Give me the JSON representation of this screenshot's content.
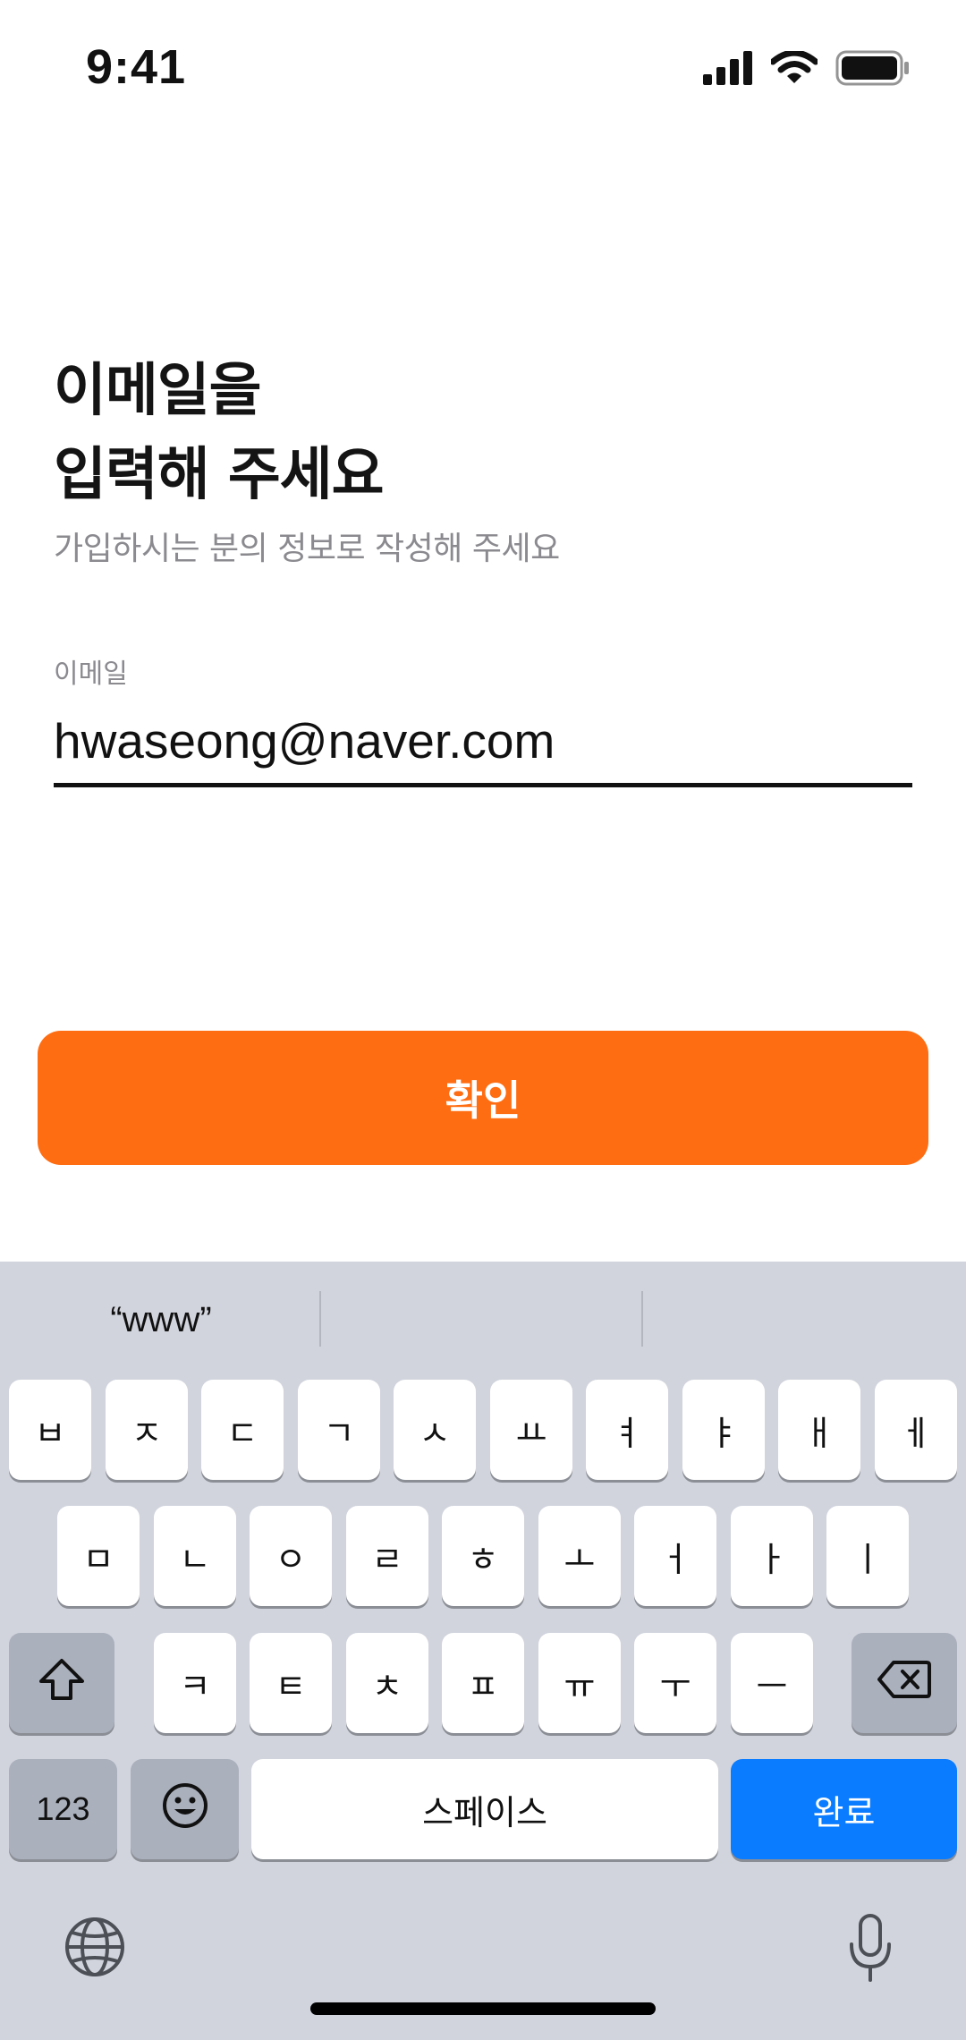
{
  "status_bar": {
    "time": "9:41",
    "icons": [
      "cellular-signal-icon",
      "wifi-icon",
      "battery-icon"
    ]
  },
  "header": {
    "title_line1": "이메일을",
    "title_line2": "입력해 주세요",
    "subtitle": "가입하시는 분의 정보로 작성해 주세요"
  },
  "email_field": {
    "label": "이메일",
    "value": "hwaseong@naver.com"
  },
  "confirm_button": {
    "label": "확인"
  },
  "colors": {
    "accent": "#ff6d12",
    "keyboard_bg": "#d1d4dd",
    "return_key": "#0a7cff"
  },
  "keyboard": {
    "suggestions": [
      "“www”",
      "",
      ""
    ],
    "row1": [
      "ㅂ",
      "ㅈ",
      "ㄷ",
      "ㄱ",
      "ㅅ",
      "ㅛ",
      "ㅕ",
      "ㅑ",
      "ㅐ",
      "ㅔ"
    ],
    "row2": [
      "ㅁ",
      "ㄴ",
      "ㅇ",
      "ㄹ",
      "ㅎ",
      "ㅗ",
      "ㅓ",
      "ㅏ",
      "ㅣ"
    ],
    "row3": [
      "ㅋ",
      "ㅌ",
      "ㅊ",
      "ㅍ",
      "ㅠ",
      "ㅜ",
      "ㅡ"
    ],
    "shift_icon": "shift-arrow-icon",
    "delete_icon": "backspace-icon",
    "numbers_label": "123",
    "emoji_icon": "emoji-icon",
    "space_label": "스페이스",
    "return_label": "완료",
    "globe_icon": "globe-icon",
    "mic_icon": "microphone-icon"
  }
}
